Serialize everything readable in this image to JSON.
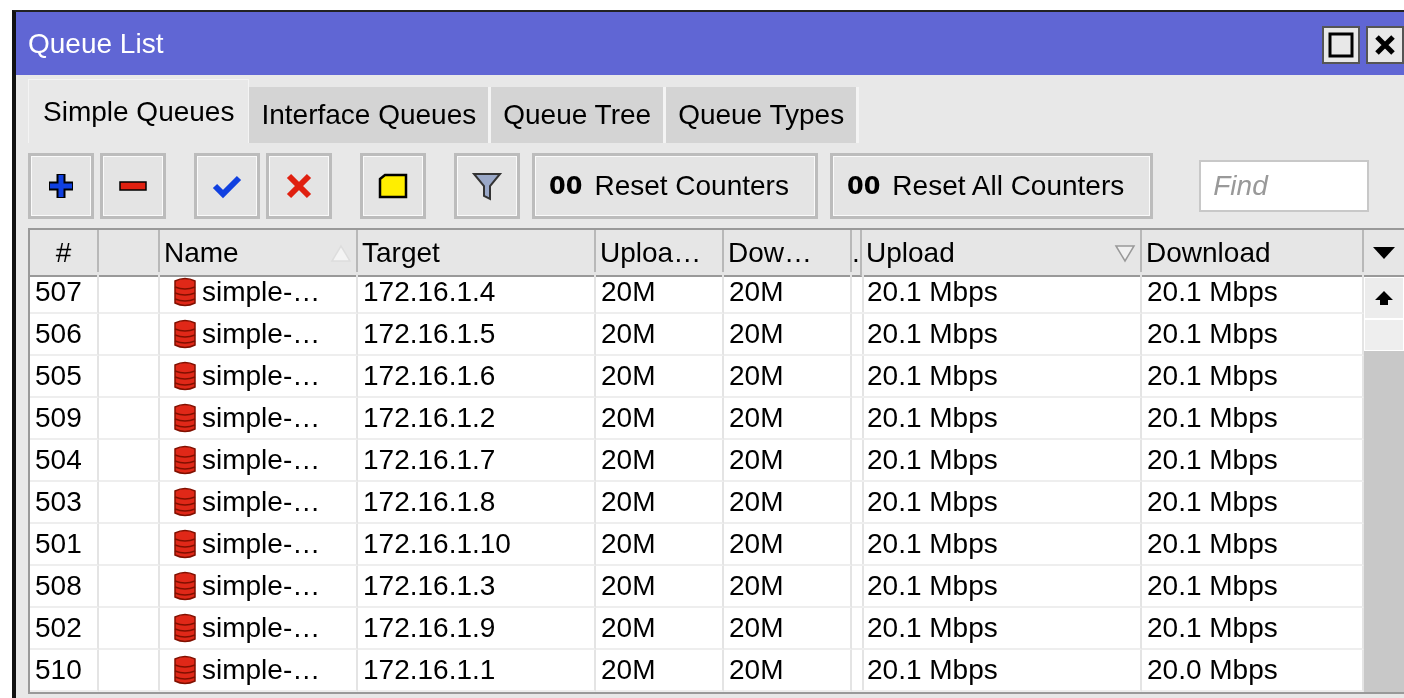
{
  "window": {
    "title": "Queue List"
  },
  "tabs": [
    {
      "label": "Simple Queues",
      "selected": true
    },
    {
      "label": "Interface Queues",
      "selected": false
    },
    {
      "label": "Queue Tree",
      "selected": false
    },
    {
      "label": "Queue Types",
      "selected": false
    }
  ],
  "toolbar": {
    "buttons": [
      {
        "kind": "add"
      },
      {
        "kind": "remove"
      },
      {
        "kind": "enable"
      },
      {
        "kind": "disable"
      },
      {
        "kind": "comment"
      },
      {
        "kind": "filter"
      },
      {
        "kind": "text",
        "badge": "00",
        "label": "Reset Counters"
      },
      {
        "kind": "text",
        "badge": "00",
        "label": "Reset All Counters"
      }
    ],
    "search": {
      "placeholder": "Find"
    }
  },
  "table": {
    "columns": [
      {
        "label": "#",
        "sorted": false
      },
      {
        "sorted": false
      },
      {
        "label": "Name",
        "sorted": true,
        "descending": false
      },
      {
        "label": "Target",
        "sorted": false
      },
      {
        "label": "Uploa…",
        "sorted": false
      },
      {
        "label": "Dow…",
        "sorted": false
      },
      {
        "label": ".",
        "sorted": false
      },
      {
        "label": "Upload",
        "sorted": true,
        "descending": true
      },
      {
        "label": "Download",
        "sorted": false
      }
    ],
    "rows": [
      [
        "507",
        "",
        "simple-…",
        "172.16.1.4",
        "20M",
        "20M",
        "",
        "20.1 Mbps",
        "20.1 Mbps"
      ],
      [
        "506",
        "",
        "simple-…",
        "172.16.1.5",
        "20M",
        "20M",
        "",
        "20.1 Mbps",
        "20.1 Mbps"
      ],
      [
        "505",
        "",
        "simple-…",
        "172.16.1.6",
        "20M",
        "20M",
        "",
        "20.1 Mbps",
        "20.1 Mbps"
      ],
      [
        "509",
        "",
        "simple-…",
        "172.16.1.2",
        "20M",
        "20M",
        "",
        "20.1 Mbps",
        "20.1 Mbps"
      ],
      [
        "504",
        "",
        "simple-…",
        "172.16.1.7",
        "20M",
        "20M",
        "",
        "20.1 Mbps",
        "20.1 Mbps"
      ],
      [
        "503",
        "",
        "simple-…",
        "172.16.1.8",
        "20M",
        "20M",
        "",
        "20.1 Mbps",
        "20.1 Mbps"
      ],
      [
        "501",
        "",
        "simple-…",
        "172.16.1.10",
        "20M",
        "20M",
        "",
        "20.1 Mbps",
        "20.1 Mbps"
      ],
      [
        "508",
        "",
        "simple-…",
        "172.16.1.3",
        "20M",
        "20M",
        "",
        "20.1 Mbps",
        "20.1 Mbps"
      ],
      [
        "502",
        "",
        "simple-…",
        "172.16.1.9",
        "20M",
        "20M",
        "",
        "20.1 Mbps",
        "20.1 Mbps"
      ],
      [
        "510",
        "",
        "simple-…",
        "172.16.1.1",
        "20M",
        "20M",
        "",
        "20.1 Mbps",
        "20.0 Mbps"
      ]
    ]
  }
}
